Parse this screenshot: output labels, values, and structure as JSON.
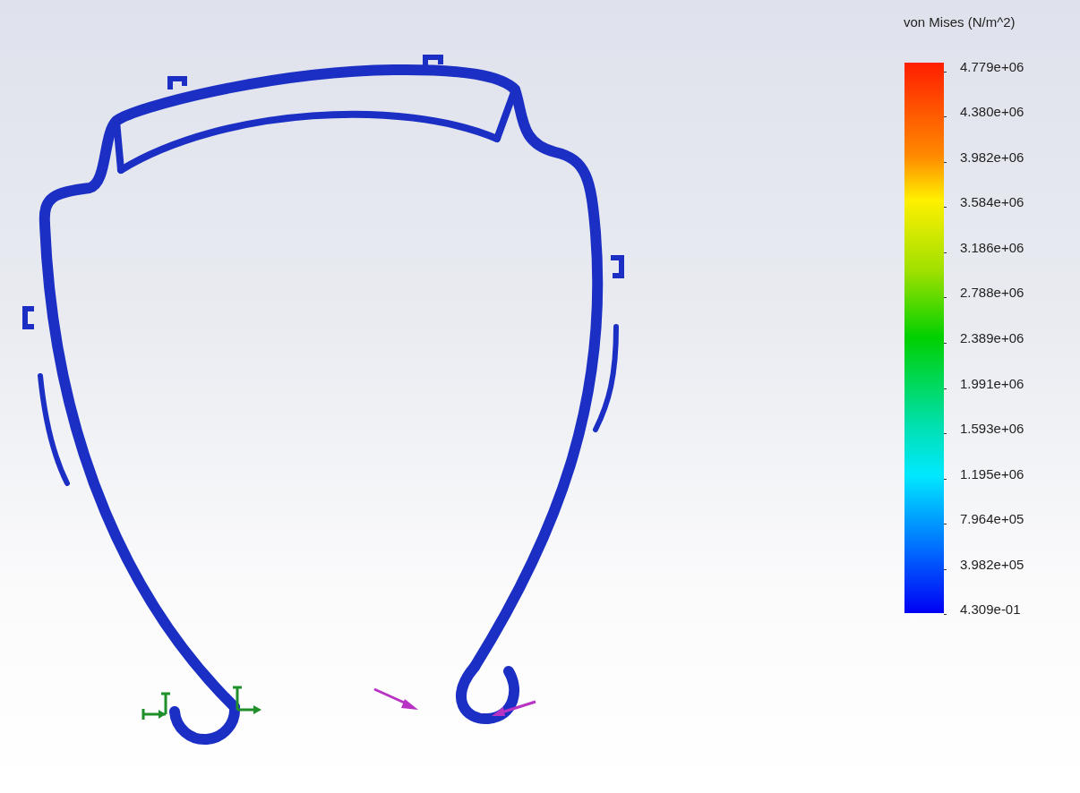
{
  "legend": {
    "title": "von Mises (N/m^2)",
    "ticks": [
      "4.779e+06",
      "4.380e+06",
      "3.982e+06",
      "3.584e+06",
      "3.186e+06",
      "2.788e+06",
      "2.389e+06",
      "1.991e+06",
      "1.593e+06",
      "1.195e+06",
      "7.964e+05",
      "3.982e+05",
      "4.309e-01"
    ]
  }
}
